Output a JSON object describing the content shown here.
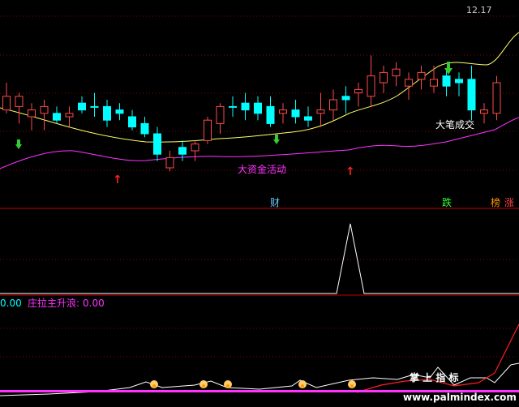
{
  "chart_data": [
    {
      "type": "candlestick",
      "price_label": "12.17",
      "candles": [
        {
          "o": 14,
          "h": 10,
          "l": 19,
          "c": 18,
          "kind": "bear"
        },
        {
          "o": 17,
          "h": 13,
          "l": 22,
          "c": 14,
          "kind": "bull"
        },
        {
          "o": 20,
          "h": 16,
          "l": 24,
          "c": 18,
          "kind": "bear"
        },
        {
          "o": 19,
          "h": 15,
          "l": 24,
          "c": 17,
          "kind": "bull"
        },
        {
          "o": 19,
          "h": 17,
          "l": 22,
          "c": 21,
          "kind": "cyan"
        },
        {
          "o": 20,
          "h": 17,
          "l": 23,
          "c": 19,
          "kind": "bull"
        },
        {
          "o": 16,
          "h": 14,
          "l": 19,
          "c": 18,
          "kind": "cyan"
        },
        {
          "o": 17,
          "h": 13,
          "l": 20,
          "c": 17,
          "kind": "cyan"
        },
        {
          "o": 17,
          "h": 15,
          "l": 23,
          "c": 21,
          "kind": "cyan"
        },
        {
          "o": 18,
          "h": 16,
          "l": 21,
          "c": 19,
          "kind": "cyan"
        },
        {
          "o": 20,
          "h": 18,
          "l": 24,
          "c": 23,
          "kind": "cyan"
        },
        {
          "o": 22,
          "h": 20,
          "l": 26,
          "c": 25,
          "kind": "cyan"
        },
        {
          "o": 25,
          "h": 23,
          "l": 33,
          "c": 31,
          "kind": "cyan"
        },
        {
          "o": 32,
          "h": 30,
          "l": 36,
          "c": 35,
          "kind": "bear"
        },
        {
          "o": 29,
          "h": 27,
          "l": 33,
          "c": 31,
          "kind": "cyan"
        },
        {
          "o": 30,
          "h": 27,
          "l": 33,
          "c": 28,
          "kind": "bull"
        },
        {
          "o": 27,
          "h": 20,
          "l": 28,
          "c": 21,
          "kind": "bear"
        },
        {
          "o": 22,
          "h": 16,
          "l": 25,
          "c": 17,
          "kind": "bull"
        },
        {
          "o": 17,
          "h": 14,
          "l": 20,
          "c": 17,
          "kind": "cyan"
        },
        {
          "o": 18,
          "h": 13,
          "l": 21,
          "c": 16,
          "kind": "cyan"
        },
        {
          "o": 16,
          "h": 14,
          "l": 21,
          "c": 19,
          "kind": "cyan"
        },
        {
          "o": 17,
          "h": 14,
          "l": 23,
          "c": 22,
          "kind": "cyan"
        },
        {
          "o": 19,
          "h": 16,
          "l": 22,
          "c": 18,
          "kind": "bull"
        },
        {
          "o": 18,
          "h": 15,
          "l": 22,
          "c": 20,
          "kind": "cyan"
        },
        {
          "o": 20,
          "h": 17,
          "l": 23,
          "c": 21,
          "kind": "cyan"
        },
        {
          "o": 18,
          "h": 13,
          "l": 23,
          "c": 19,
          "kind": "bull"
        },
        {
          "o": 18,
          "h": 12,
          "l": 21,
          "c": 15,
          "kind": "bull"
        },
        {
          "o": 15,
          "h": 11,
          "l": 19,
          "c": 14,
          "kind": "cyan"
        },
        {
          "o": 13,
          "h": 10,
          "l": 17,
          "c": 12,
          "kind": "bull"
        },
        {
          "o": 14,
          "h": 2,
          "l": 17,
          "c": 8,
          "kind": "bull"
        },
        {
          "o": 10,
          "h": 5,
          "l": 13,
          "c": 7,
          "kind": "bear"
        },
        {
          "o": 8,
          "h": 4,
          "l": 11,
          "c": 6,
          "kind": "bear"
        },
        {
          "o": 11,
          "h": 7,
          "l": 15,
          "c": 9,
          "kind": "bear"
        },
        {
          "o": 9,
          "h": 5,
          "l": 12,
          "c": 7,
          "kind": "bull"
        },
        {
          "o": 9,
          "h": 5,
          "l": 13,
          "c": 11,
          "kind": "bear"
        },
        {
          "o": 11,
          "h": 6,
          "l": 14,
          "c": 8,
          "kind": "cyan"
        },
        {
          "o": 10,
          "h": 7,
          "l": 14,
          "c": 9,
          "kind": "cyan"
        },
        {
          "o": 9,
          "h": 5,
          "l": 21,
          "c": 18,
          "kind": "cyan"
        },
        {
          "o": 18,
          "h": 16,
          "l": 22,
          "c": 19,
          "kind": "bear"
        },
        {
          "o": 19,
          "h": 8,
          "l": 21,
          "c": 10,
          "kind": "bull"
        }
      ],
      "labels": {
        "big_volume": "大笔成交",
        "capital_activity": "大资金活动"
      },
      "arrows": [
        "↑",
        "↑"
      ],
      "markers": {
        "cai": "财",
        "die": "跌",
        "bang": "榜",
        "zhang": "涨"
      }
    },
    {
      "type": "line",
      "description_values": [
        0,
        0,
        0,
        0,
        0,
        0,
        0,
        0,
        0,
        0,
        0,
        0,
        0,
        0,
        0,
        0,
        0,
        0,
        0,
        0,
        0,
        0,
        0,
        0,
        0,
        0,
        0,
        0,
        0,
        0,
        0,
        0,
        0,
        0,
        0,
        0,
        0,
        0,
        0,
        0,
        1,
        0,
        0,
        0,
        0,
        0,
        0,
        0,
        0,
        0,
        0,
        0,
        0,
        0,
        0,
        0,
        0,
        0,
        0,
        0,
        0,
        0,
        0,
        0,
        0,
        0,
        0,
        0,
        0,
        0,
        0,
        0,
        0,
        0,
        0,
        0,
        0
      ]
    },
    {
      "type": "line",
      "header_value_left": "0.00",
      "header_name": "庄拉主升浪:",
      "header_value_right": "0.00",
      "series": [
        {
          "values": [
            0,
            0,
            0,
            0,
            0,
            0,
            0,
            0,
            0,
            0,
            0,
            0,
            0,
            0,
            0,
            0,
            0,
            0,
            0,
            0,
            0,
            0,
            0,
            0,
            0,
            0,
            0,
            0,
            0,
            0,
            0,
            0,
            0,
            0,
            0,
            0,
            0,
            0,
            0,
            0,
            0,
            0,
            0,
            0,
            0,
            0,
            0,
            0,
            0,
            0,
            0,
            0,
            0,
            0,
            0,
            0,
            0,
            0,
            0,
            0,
            0,
            0,
            0,
            0,
            0,
            0,
            0,
            0,
            0,
            0,
            0,
            0,
            0,
            0,
            0,
            0,
            0,
            0,
            0,
            0
          ]
        },
        {
          "values": [
            0,
            0,
            0,
            0,
            0,
            0,
            0,
            0,
            0,
            0,
            0,
            0,
            0,
            0,
            0,
            0,
            0,
            0,
            0,
            0,
            0,
            0,
            0,
            0,
            0,
            0,
            0,
            0,
            0,
            0,
            0,
            0,
            0,
            0,
            0,
            0,
            0,
            0,
            0,
            0,
            0,
            0,
            0,
            0,
            0,
            0,
            0,
            0,
            0,
            0,
            0,
            0,
            0,
            0,
            0,
            0,
            0,
            0,
            0,
            0,
            0,
            0,
            0,
            0,
            0,
            0,
            0,
            0,
            0,
            0,
            0,
            0,
            0,
            0,
            0,
            0,
            0,
            0,
            0,
            0
          ]
        }
      ],
      "watermark_cn": "掌 上 指 标",
      "watermark_url": "www.palmindex.com"
    }
  ],
  "colors": {
    "bull": "#ff4a4a",
    "bear_fill": "#00ffff",
    "bear_line": "#00ffff",
    "ma_yellow": "#ffff66",
    "ma_magenta": "#ff33ff",
    "white": "#ffffff",
    "grid": "#8b0000"
  }
}
